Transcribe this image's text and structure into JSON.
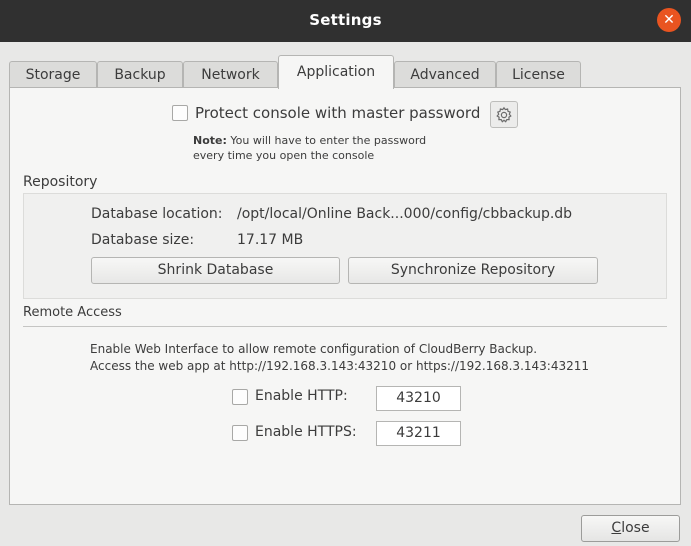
{
  "window": {
    "title": "Settings",
    "close_glyph": "✕"
  },
  "tabs": [
    {
      "label": "Storage",
      "active": false
    },
    {
      "label": "Backup",
      "active": false
    },
    {
      "label": "Network",
      "active": false
    },
    {
      "label": "Application",
      "active": true
    },
    {
      "label": "Advanced",
      "active": false
    },
    {
      "label": "License",
      "active": false
    }
  ],
  "console": {
    "protect_label": "Protect console with master password",
    "protect_checked": false,
    "settings_icon": "gear-icon",
    "note_bold": "Note:",
    "note_line1": " You will have to enter the password",
    "note_line2": "every time you open the console"
  },
  "repository": {
    "section_label": "Repository",
    "db_location_label": "Database location:",
    "db_location_value": "/opt/local/Online Back...000/config/cbbackup.db",
    "db_size_label": "Database size:",
    "db_size_value": "17.17 MB",
    "shrink_button": "Shrink Database",
    "sync_button": "Synchronize Repository"
  },
  "remote": {
    "section_label": "Remote Access",
    "info_line1": "Enable Web Interface to allow remote configuration of CloudBerry Backup.",
    "info_line2": "Access the web app at http://192.168.3.143:43210 or https://192.168.3.143:43211",
    "http_label": "Enable HTTP:",
    "http_checked": false,
    "http_port": "43210",
    "https_label": "Enable HTTPS:",
    "https_checked": false,
    "https_port": "43211"
  },
  "footer": {
    "close_mnemonic": "C",
    "close_rest": "lose"
  },
  "colors": {
    "titlebar": "#303030",
    "close_accent": "#e95420",
    "panel": "#f6f6f5"
  }
}
